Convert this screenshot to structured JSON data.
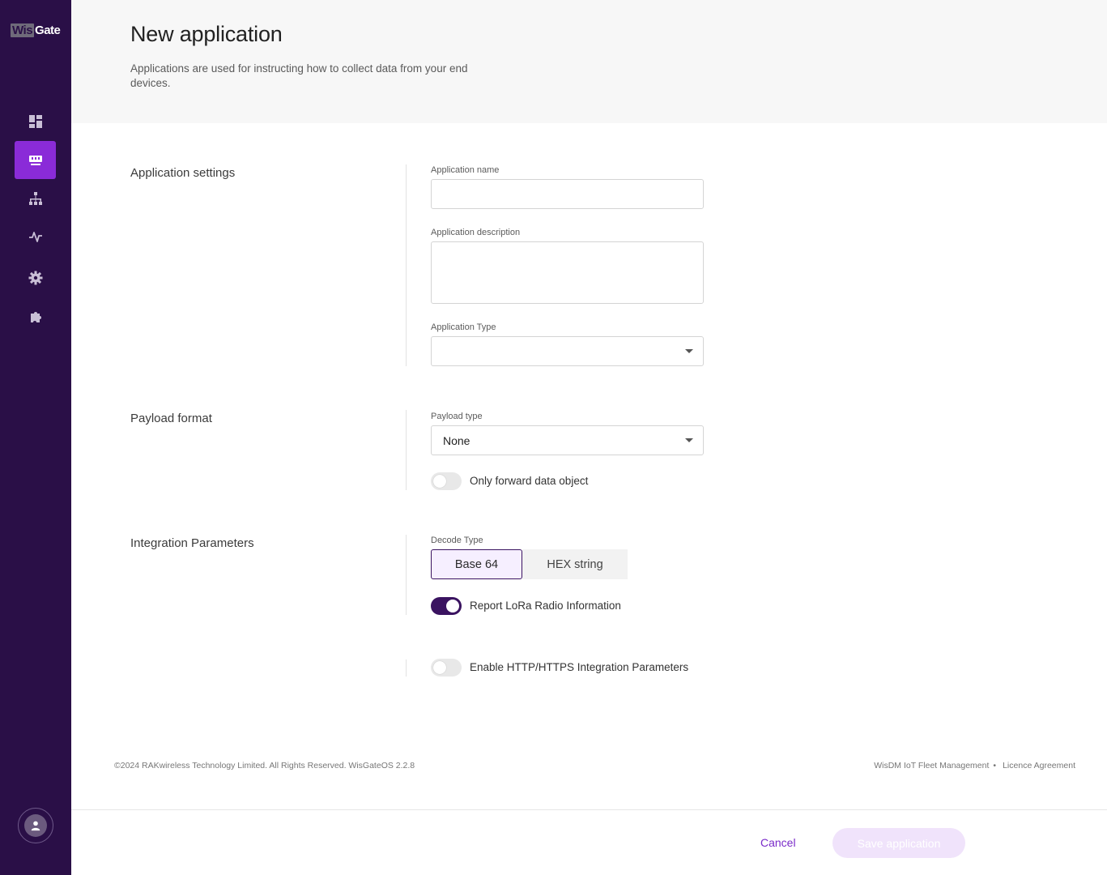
{
  "brand": {
    "logo_part1": "Wis",
    "logo_part2": "Gate"
  },
  "sidebar": {
    "items": [
      {
        "name": "dashboard",
        "icon": "dashboard-icon",
        "active": false
      },
      {
        "name": "applications",
        "icon": "applications-icon",
        "active": true
      },
      {
        "name": "network",
        "icon": "network-icon",
        "active": false
      },
      {
        "name": "monitoring",
        "icon": "activity-icon",
        "active": false
      },
      {
        "name": "settings",
        "icon": "gear-icon",
        "active": false
      },
      {
        "name": "extensions",
        "icon": "puzzle-icon",
        "active": false
      }
    ],
    "accent_color": "#8a2bd8",
    "bg_color": "#2a0f47"
  },
  "header": {
    "title": "New application",
    "subtitle": "Applications are used for instructing how to collect data from your end devices."
  },
  "app_settings": {
    "section_label": "Application settings",
    "name_label": "Application name",
    "name_value": "",
    "description_label": "Application description",
    "description_value": "",
    "type_label": "Application Type",
    "type_value": ""
  },
  "payload": {
    "section_label": "Payload format",
    "type_label": "Payload type",
    "type_value": "None",
    "forward_label": "Only forward data object",
    "forward_enabled": false
  },
  "integration": {
    "section_label": "Integration Parameters",
    "decode_label": "Decode Type",
    "decode_options": [
      "Base 64",
      "HEX string"
    ],
    "decode_selected": "Base 64",
    "lora_label": "Report LoRa Radio Information",
    "lora_enabled": true,
    "http_label": "Enable HTTP/HTTPS Integration Parameters",
    "http_enabled": false
  },
  "footer": {
    "copyright": "©2024 RAKwireless Technology Limited. All Rights Reserved. WisGateOS 2.2.8",
    "link1": "WisDM IoT Fleet Management",
    "separator": "•",
    "link2": "Licence Agreement"
  },
  "actions": {
    "cancel_label": "Cancel",
    "save_label": "Save application"
  }
}
